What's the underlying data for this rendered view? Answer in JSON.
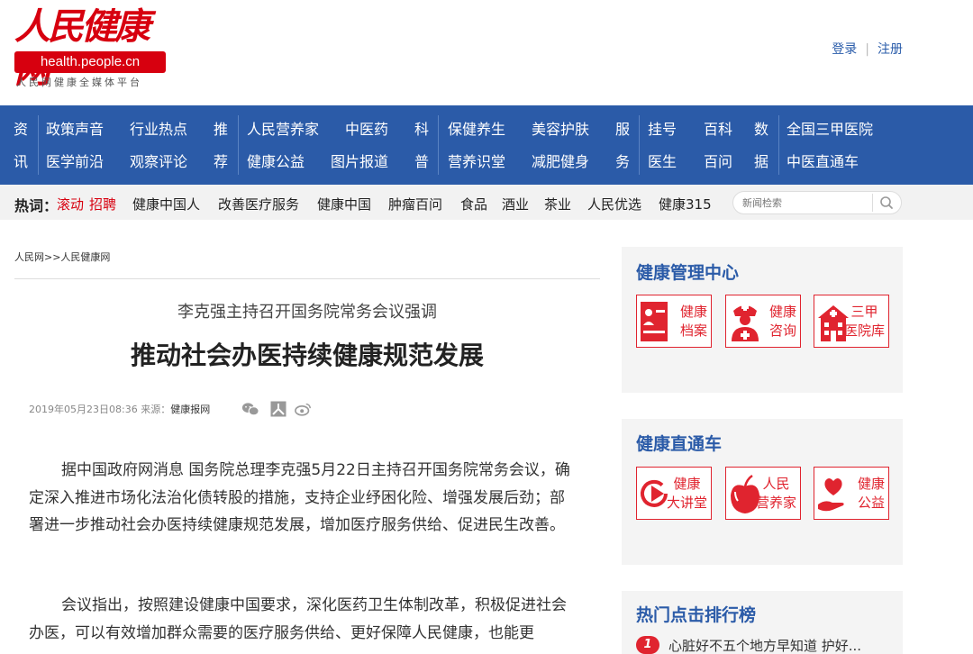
{
  "header": {
    "logo_text": "人民健康网",
    "logo_url": "health.people.cn",
    "logo_tagline": "人民网健康全媒体平台",
    "login": "登录",
    "register": "注册"
  },
  "nav": {
    "groups": [
      {
        "tag": [
          "资",
          "讯"
        ],
        "items": [
          "政策声音",
          "行业热点",
          "医学前沿",
          "观察评论"
        ]
      },
      {
        "tag": [
          "推",
          "荐"
        ],
        "items": [
          "人民营养家",
          "中医药",
          "健康公益",
          "图片报道"
        ]
      },
      {
        "tag": [
          "科",
          "普"
        ],
        "items": [
          "保健养生",
          "美容护肤",
          "营养识堂",
          "减肥健身"
        ]
      },
      {
        "tag": [
          "服",
          "务"
        ],
        "items": [
          "挂号",
          "百科",
          "医生",
          "百问"
        ]
      },
      {
        "tag": [
          "数",
          "据"
        ],
        "items": [
          "全国三甲医院",
          "中医直通车"
        ]
      }
    ]
  },
  "hotbar": {
    "label": "热词：",
    "items": [
      "滚动",
      "招聘",
      "健康中国人",
      "改善医疗服务",
      "健康中国",
      "肿瘤百问",
      "食品",
      "酒业",
      "茶业",
      "人民优选",
      "健康315"
    ],
    "search_placeholder": "新闻检索"
  },
  "article": {
    "breadcrumb": "人民网>>人民健康网",
    "subtitle": "李克强主持召开国务院常务会议强调",
    "title": "推动社会办医持续健康规范发展",
    "datetime": "2019年05月23日08:36",
    "source_label": "来源：",
    "source": "健康报网",
    "paragraphs": [
      "据中国政府网消息 国务院总理李克强5月22日主持召开国务院常务会议，确定深入推进市场化法治化债转股的措施，支持企业纾困化险、增强发展后劲；部署进一步推动社会办医持续健康规范发展，增加医疗服务供给、促进民生改善。",
      "会议指出，按照建设健康中国要求，深化医药卫生体制改革，积极促进社会办医，可以有效增加群众需要的医疗服务供给、更好保障人民健康，也能更"
    ]
  },
  "sidebar": {
    "health_center": {
      "title": "健康管理中心",
      "tiles": [
        {
          "line1": "健康",
          "line2": "档案"
        },
        {
          "line1": "健康",
          "line2": "咨询"
        },
        {
          "line1": "三甲",
          "line2": "医院库"
        }
      ]
    },
    "health_express": {
      "title": "健康直通车",
      "tiles": [
        {
          "line1": "健康",
          "line2": "大讲堂"
        },
        {
          "line1": "人民",
          "line2": "营养家"
        },
        {
          "line1": "健康",
          "line2": "公益"
        }
      ]
    },
    "ranking": {
      "title": "热门点击排行榜",
      "items": [
        {
          "rank": "1",
          "text": "心脏好不五个地方早知道 护好..."
        }
      ]
    }
  },
  "colors": {
    "brand_red": "#d7000f",
    "nav_blue": "#2b5ba8",
    "tile_red": "#e0242f"
  }
}
